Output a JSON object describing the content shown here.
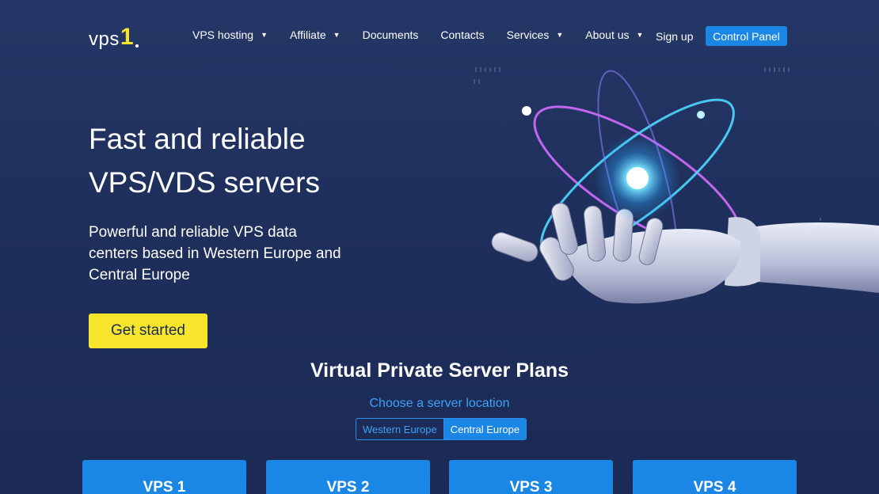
{
  "header": {
    "logo": {
      "text": "vps",
      "number": "1"
    },
    "nav": [
      {
        "label": "VPS hosting",
        "has_dropdown": true
      },
      {
        "label": "Affiliate",
        "has_dropdown": true
      },
      {
        "label": "Documents",
        "has_dropdown": false
      },
      {
        "label": "Contacts",
        "has_dropdown": false
      },
      {
        "label": "Services",
        "has_dropdown": true
      },
      {
        "label": "About us",
        "has_dropdown": true
      }
    ],
    "sign_up": "Sign up",
    "control_panel": "Control Panel",
    "caret": "▼"
  },
  "hero": {
    "title_line1": "Fast and reliable",
    "title_line2": "VPS/VDS servers",
    "subtitle_line1": "Powerful and reliable VPS data",
    "subtitle_line2": "centers based in Western Europe and",
    "subtitle_line3": "Central Europe",
    "cta": "Get started"
  },
  "plans": {
    "title": "Virtual Private Server Plans",
    "location_prompt": "Choose a server location",
    "locations": [
      {
        "label": "Western Europe",
        "active": false
      },
      {
        "label": "Central Europe",
        "active": true
      }
    ],
    "cards": [
      {
        "name": "VPS 1"
      },
      {
        "name": "VPS 2"
      },
      {
        "name": "VPS 3"
      },
      {
        "name": "VPS 4"
      }
    ]
  },
  "colors": {
    "background": "#1f2f5c",
    "accent_blue": "#1a86e6",
    "accent_yellow": "#f7e52b",
    "link_blue": "#3ea2f5"
  },
  "icons": {
    "hero_art": "robot-hand-holding-atom"
  }
}
